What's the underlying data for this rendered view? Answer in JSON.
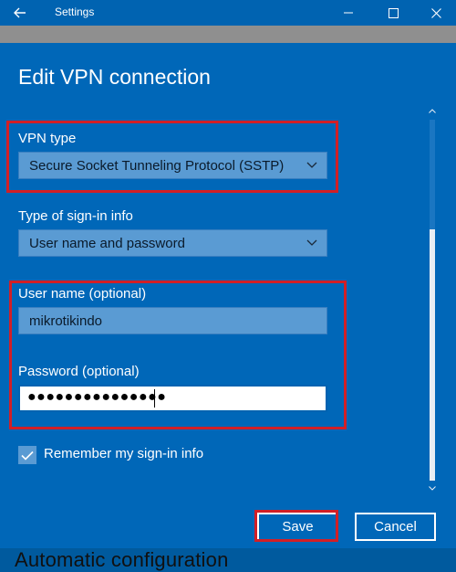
{
  "window": {
    "title": "Settings"
  },
  "behind": {
    "text": "Automatic configuration"
  },
  "dialog": {
    "title": "Edit VPN connection",
    "vpn_type": {
      "label": "VPN type",
      "value": "Secure Socket Tunneling Protocol (SSTP)"
    },
    "sign_in_type": {
      "label": "Type of sign-in info",
      "value": "User name and password"
    },
    "username": {
      "label": "User name (optional)",
      "value": "mikrotikindo"
    },
    "password": {
      "label": "Password (optional)",
      "masked_value": "●●●●●●●●●●●●●●●"
    },
    "remember": {
      "label": "Remember my sign-in info",
      "checked": true
    },
    "buttons": {
      "save": "Save",
      "cancel": "Cancel"
    }
  },
  "colors": {
    "dialog_background": "#0067b8",
    "titlebar": "#0063b1",
    "field_background": "#5a9bd3",
    "highlight": "#d21f26"
  }
}
